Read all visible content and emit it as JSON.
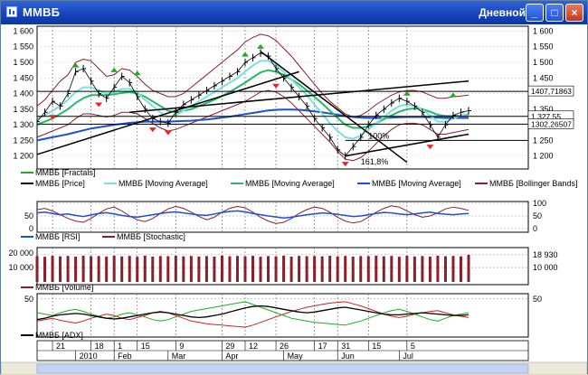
{
  "window": {
    "title": "ММВБ",
    "mode": "Дневной",
    "buttons": {
      "min": "_",
      "max": "□",
      "close": "×"
    }
  },
  "colors": {
    "price": "#000000",
    "fractal_up": "#22aa22",
    "fractal_down": "#ee2222",
    "ma_fast": "#7de0e0",
    "ma_mid": "#22bb66",
    "ma_slow": "#1d4fd8",
    "bollinger": "#8b1f2b",
    "rsi": "#1d4fd8",
    "stochastic": "#8b1f2b",
    "volume": "#8b1f2b",
    "adx": "#1d4fd8"
  },
  "chart_data": [
    {
      "type": "line",
      "panel": "price",
      "legend": [
        "ММВБ [Fractals]",
        "ММВБ [Price]",
        "ММВБ [Moving Average]",
        "ММВБ [Moving Average]",
        "ММВБ [Moving Average]",
        "ММВБ [Bollinger Bands]"
      ],
      "ylim": [
        1170,
        1610
      ],
      "yticks_left": [
        "1 600",
        "1 550",
        "1 500",
        "1 450",
        "1 400",
        "1 350",
        "1 300",
        "1 250",
        "1 200"
      ],
      "yticks_right": [
        "1 600",
        "1 550",
        "1 500",
        "1 450",
        "1 400",
        "1 350",
        "1 300",
        "1 250",
        "1 200"
      ],
      "right_labels": [
        {
          "text": "1407,71863",
          "value": 1407
        },
        {
          "text": "1 327,55",
          "value": 1327
        },
        {
          "text": "1302,26507",
          "value": 1302
        }
      ],
      "price_labels": [
        "100%",
        "161,8%"
      ],
      "price_close": [
        1310,
        1340,
        1375,
        1360,
        1400,
        1470,
        1480,
        1440,
        1400,
        1385,
        1420,
        1455,
        1435,
        1390,
        1350,
        1320,
        1310,
        1305,
        1340,
        1365,
        1380,
        1395,
        1410,
        1425,
        1440,
        1455,
        1470,
        1500,
        1515,
        1530,
        1520,
        1480,
        1450,
        1420,
        1390,
        1360,
        1320,
        1290,
        1260,
        1220,
        1200,
        1230,
        1260,
        1300,
        1330,
        1350,
        1370,
        1385,
        1375,
        1360,
        1340,
        1300,
        1260,
        1300,
        1330,
        1340,
        1345
      ],
      "ma_fast": [
        1320,
        1330,
        1345,
        1360,
        1380,
        1405,
        1420,
        1420,
        1410,
        1400,
        1405,
        1415,
        1415,
        1405,
        1380,
        1360,
        1340,
        1325,
        1330,
        1345,
        1360,
        1375,
        1390,
        1405,
        1420,
        1435,
        1450,
        1470,
        1490,
        1505,
        1505,
        1490,
        1470,
        1445,
        1420,
        1395,
        1365,
        1335,
        1305,
        1280,
        1260,
        1255,
        1265,
        1285,
        1305,
        1325,
        1345,
        1360,
        1365,
        1360,
        1350,
        1330,
        1310,
        1310,
        1320,
        1330,
        1335
      ],
      "ma_mid": [
        1300,
        1310,
        1320,
        1335,
        1350,
        1370,
        1385,
        1395,
        1395,
        1395,
        1398,
        1402,
        1405,
        1400,
        1390,
        1375,
        1360,
        1345,
        1340,
        1345,
        1350,
        1360,
        1370,
        1380,
        1392,
        1405,
        1420,
        1435,
        1452,
        1468,
        1475,
        1470,
        1460,
        1445,
        1430,
        1410,
        1390,
        1368,
        1345,
        1322,
        1300,
        1290,
        1290,
        1295,
        1305,
        1318,
        1330,
        1342,
        1350,
        1352,
        1350,
        1342,
        1332,
        1328,
        1328,
        1330,
        1332
      ],
      "ma_slow": [
        1250,
        1255,
        1260,
        1265,
        1270,
        1276,
        1282,
        1288,
        1292,
        1296,
        1300,
        1303,
        1306,
        1308,
        1310,
        1310,
        1310,
        1310,
        1311,
        1312,
        1313,
        1315,
        1317,
        1320,
        1323,
        1326,
        1330,
        1334,
        1338,
        1342,
        1346,
        1348,
        1349,
        1349,
        1348,
        1346,
        1343,
        1340,
        1336,
        1332,
        1328,
        1325,
        1323,
        1322,
        1322,
        1322,
        1323,
        1324,
        1325,
        1325,
        1325,
        1324,
        1323,
        1322,
        1322,
        1322,
        1322
      ],
      "boll_upper": [
        1360,
        1380,
        1410,
        1440,
        1460,
        1500,
        1510,
        1505,
        1480,
        1455,
        1460,
        1480,
        1475,
        1455,
        1430,
        1410,
        1400,
        1390,
        1390,
        1400,
        1420,
        1440,
        1460,
        1480,
        1500,
        1520,
        1540,
        1565,
        1580,
        1590,
        1585,
        1570,
        1545,
        1520,
        1490,
        1460,
        1430,
        1400,
        1375,
        1355,
        1335,
        1325,
        1330,
        1345,
        1365,
        1380,
        1395,
        1405,
        1410,
        1410,
        1405,
        1395,
        1385,
        1385,
        1390,
        1392,
        1395
      ],
      "boll_lower": [
        1260,
        1270,
        1280,
        1290,
        1300,
        1320,
        1335,
        1335,
        1330,
        1325,
        1330,
        1340,
        1340,
        1335,
        1320,
        1305,
        1290,
        1280,
        1285,
        1295,
        1305,
        1315,
        1325,
        1335,
        1345,
        1355,
        1365,
        1375,
        1390,
        1405,
        1410,
        1405,
        1390,
        1370,
        1345,
        1320,
        1295,
        1270,
        1245,
        1215,
        1190,
        1185,
        1195,
        1215,
        1240,
        1265,
        1285,
        1300,
        1305,
        1305,
        1300,
        1285,
        1270,
        1270,
        1275,
        1280,
        1285
      ],
      "fractals_up": [
        {
          "i": 5,
          "v": 1475
        },
        {
          "i": 10,
          "v": 1460
        },
        {
          "i": 13,
          "v": 1450
        },
        {
          "i": 27,
          "v": 1510
        },
        {
          "i": 29,
          "v": 1535
        },
        {
          "i": 48,
          "v": 1385
        },
        {
          "i": 54,
          "v": 1380
        }
      ],
      "fractals_down": [
        {
          "i": 2,
          "v": 1340
        },
        {
          "i": 8,
          "v": 1380
        },
        {
          "i": 15,
          "v": 1300
        },
        {
          "i": 17,
          "v": 1290
        },
        {
          "i": 31,
          "v": 1440
        },
        {
          "i": 40,
          "v": 1190
        },
        {
          "i": 51,
          "v": 1245
        }
      ]
    },
    {
      "type": "line",
      "panel": "oscillators",
      "legend": [
        "ММВБ [RSI]",
        "ММВБ [Stochastic]"
      ],
      "ylim": [
        0,
        100
      ],
      "yticks_left": [
        "50",
        "0"
      ],
      "yticks_right": [
        "100",
        "50",
        "0"
      ],
      "rsi": [
        62,
        65,
        60,
        55,
        58,
        52,
        48,
        54,
        60,
        63,
        58,
        52,
        48,
        45,
        50,
        55,
        60,
        64,
        66,
        62,
        58,
        54,
        52,
        58,
        64,
        68,
        70,
        66,
        60,
        55,
        50,
        46,
        42,
        45,
        50,
        55,
        58,
        62,
        60,
        56,
        52,
        48,
        50,
        55,
        60,
        64,
        62,
        58,
        55,
        58,
        62,
        65,
        60,
        57,
        55,
        58,
        60
      ],
      "stochastic": [
        75,
        80,
        70,
        55,
        40,
        30,
        25,
        40,
        60,
        78,
        85,
        70,
        50,
        35,
        28,
        40,
        60,
        78,
        88,
        80,
        65,
        48,
        35,
        45,
        65,
        80,
        88,
        82,
        65,
        45,
        30,
        20,
        25,
        40,
        60,
        75,
        85,
        80,
        65,
        45,
        30,
        22,
        28,
        45,
        65,
        80,
        90,
        85,
        70,
        55,
        45,
        50,
        62,
        78,
        85,
        80,
        72
      ]
    },
    {
      "type": "bar",
      "panel": "volume",
      "legend": [
        "ММВБ [Volume]"
      ],
      "yticks_left": [
        "20 000",
        "10 000"
      ],
      "yticks_right": [
        "18 930",
        "10 000"
      ],
      "volume": [
        18000,
        17500,
        18200,
        17800,
        18100,
        17600,
        18300,
        17900,
        18000,
        17700,
        18200,
        17800,
        18100,
        17500,
        18300,
        17600,
        18000,
        17900,
        18200,
        17800,
        18100,
        17700,
        18000,
        17600,
        18300,
        17900,
        18100,
        17800,
        18200,
        17500,
        18000,
        17700,
        18300,
        17600,
        18100,
        17900,
        18000,
        17800,
        18200,
        17700,
        18100,
        17600,
        18000,
        17900,
        18300,
        17800,
        18100,
        17500,
        18200,
        17700,
        18000,
        17600,
        18300,
        17900,
        18100,
        17800,
        18930
      ]
    },
    {
      "type": "line",
      "panel": "adx",
      "legend": [
        "ММВБ [ADX]"
      ],
      "ylim": [
        0,
        55
      ],
      "yticks_left": [
        "50"
      ],
      "yticks_right": [
        "50"
      ],
      "adx": [
        20,
        22,
        25,
        27,
        28,
        29,
        28,
        26,
        24,
        22,
        21,
        22,
        24,
        26,
        28,
        30,
        31,
        30,
        28,
        26,
        24,
        23,
        24,
        26,
        28,
        31,
        34,
        37,
        39,
        40,
        39,
        37,
        35,
        33,
        31,
        30,
        31,
        33,
        35,
        37,
        38,
        36,
        34,
        32,
        30,
        28,
        27,
        27,
        28,
        29,
        30,
        29,
        28,
        27,
        26,
        26,
        27
      ],
      "di_plus": [
        30,
        28,
        26,
        30,
        33,
        35,
        32,
        28,
        25,
        22,
        24,
        28,
        30,
        27,
        24,
        20,
        18,
        20,
        24,
        28,
        32,
        34,
        36,
        38,
        40,
        42,
        44,
        46,
        42,
        38,
        34,
        30,
        26,
        22,
        20,
        18,
        16,
        15,
        14,
        13,
        12,
        15,
        18,
        22,
        26,
        30,
        33,
        35,
        32,
        28,
        24,
        20,
        18,
        22,
        26,
        28,
        30
      ],
      "di_minus": [
        18,
        20,
        22,
        19,
        17,
        15,
        18,
        22,
        25,
        28,
        26,
        22,
        20,
        23,
        26,
        30,
        32,
        30,
        26,
        22,
        18,
        16,
        14,
        13,
        12,
        11,
        10,
        9,
        12,
        16,
        20,
        24,
        28,
        32,
        35,
        38,
        40,
        42,
        44,
        45,
        46,
        43,
        40,
        36,
        32,
        28,
        25,
        23,
        25,
        28,
        30,
        32,
        33,
        30,
        27,
        25,
        23
      ]
    }
  ],
  "time_axis": {
    "days": [
      {
        "i": 2,
        "label": "21"
      },
      {
        "i": 7,
        "label": "18"
      },
      {
        "i": 10,
        "label": "1"
      },
      {
        "i": 13,
        "label": "15"
      },
      {
        "i": 18,
        "label": "9"
      },
      {
        "i": 24,
        "label": "29"
      },
      {
        "i": 27,
        "label": "12"
      },
      {
        "i": 31,
        "label": "26"
      },
      {
        "i": 36,
        "label": "17"
      },
      {
        "i": 39,
        "label": "31"
      },
      {
        "i": 43,
        "label": "15"
      },
      {
        "i": 48,
        "label": "5"
      }
    ],
    "months": [
      {
        "i": 5,
        "label": "2010"
      },
      {
        "i": 10,
        "label": "Feb"
      },
      {
        "i": 17,
        "label": "Mar"
      },
      {
        "i": 24,
        "label": "Apr"
      },
      {
        "i": 32,
        "label": "May"
      },
      {
        "i": 39,
        "label": "Jun"
      },
      {
        "i": 47,
        "label": "Jul"
      }
    ]
  }
}
